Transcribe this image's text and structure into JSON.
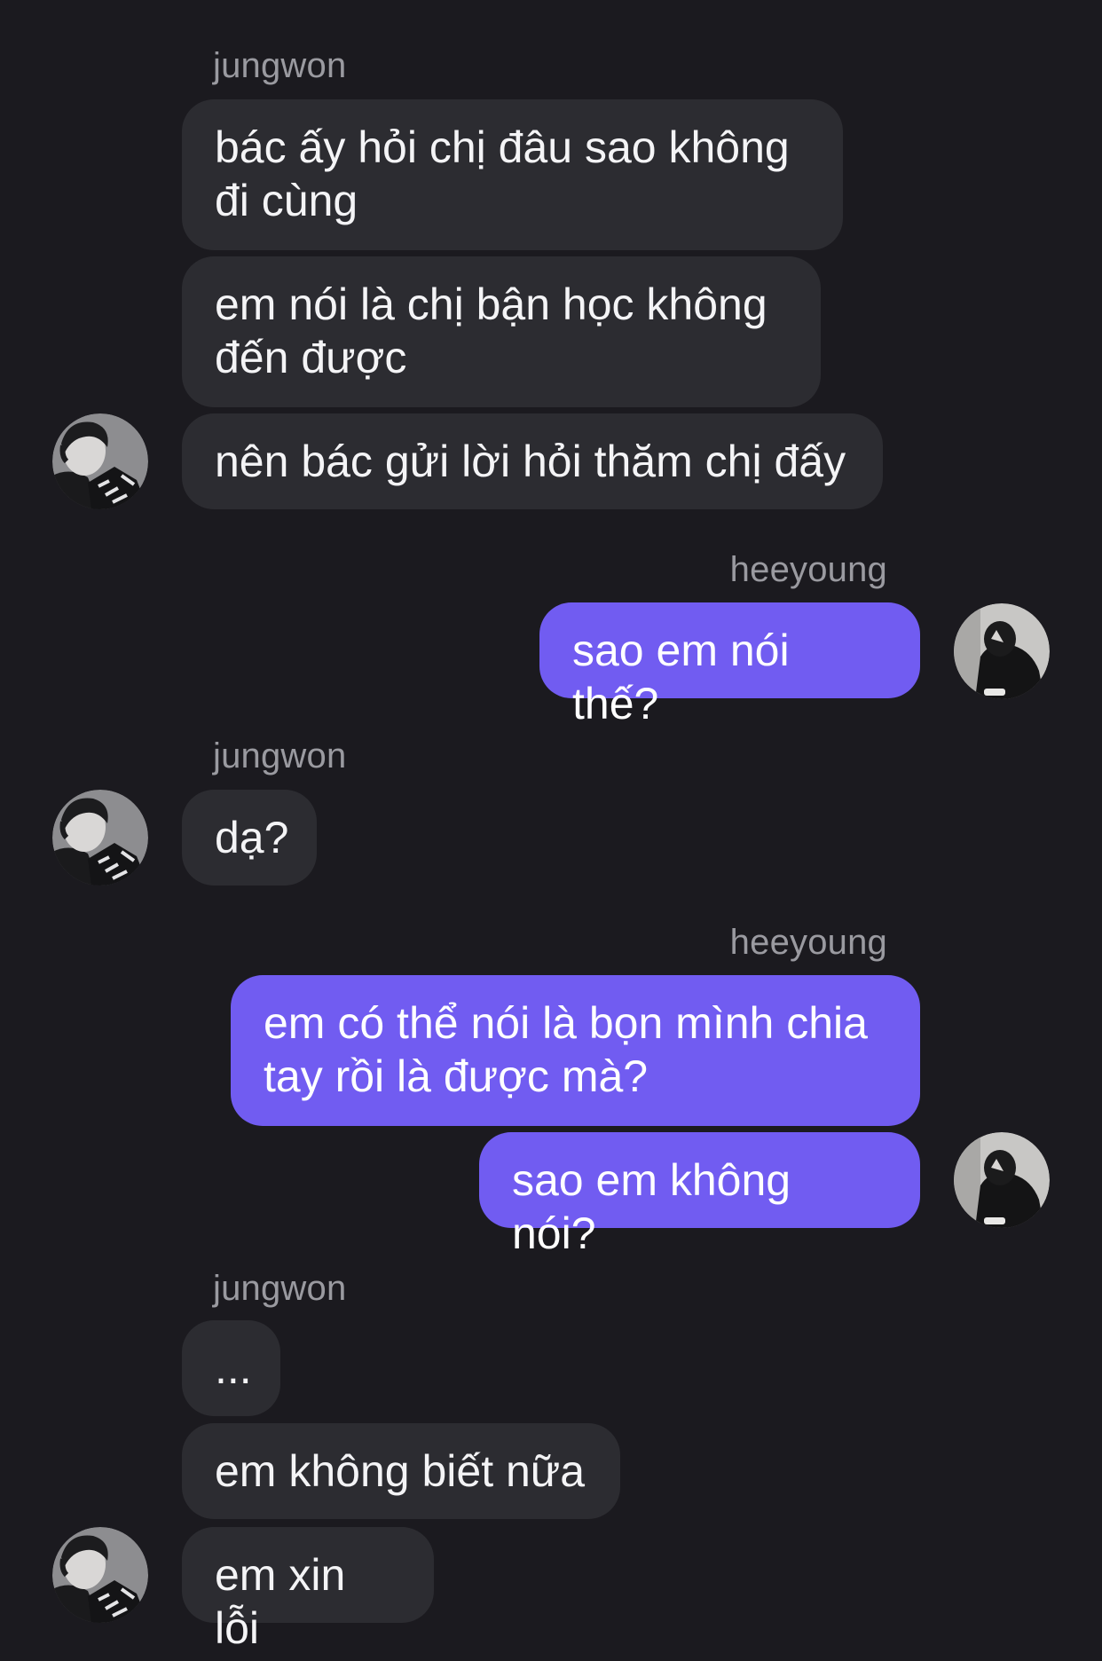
{
  "conversation": {
    "participants": {
      "other": "jungwon",
      "self": "heeyoung"
    },
    "groups": [
      {
        "sender": "jungwon",
        "side": "incoming",
        "messages": [
          "bác ấy hỏi chị đâu sao không đi cùng",
          "em nói là chị bận học không đến được",
          "nên bác gửi lời hỏi thăm chị đấy"
        ]
      },
      {
        "sender": "heeyoung",
        "side": "outgoing",
        "messages": [
          "sao em nói thế?"
        ]
      },
      {
        "sender": "jungwon",
        "side": "incoming",
        "messages": [
          "dạ?"
        ]
      },
      {
        "sender": "heeyoung",
        "side": "outgoing",
        "messages": [
          "em có thể nói là bọn mình chia tay rồi là được mà?",
          "sao em không nói?"
        ]
      },
      {
        "sender": "jungwon",
        "side": "incoming",
        "messages": [
          "...",
          "em không biết nữa",
          "em xin lỗi"
        ]
      }
    ]
  },
  "colors": {
    "background": "#1b1a1f",
    "incoming_bubble": "#2c2c31",
    "outgoing_bubble": "#715cf1",
    "sender_name": "#9a9aa0",
    "message_text": "#f4f4f6"
  },
  "icons": {
    "incoming_avatar": "profile-photo-jungwon",
    "outgoing_avatar": "profile-photo-heeyoung"
  }
}
